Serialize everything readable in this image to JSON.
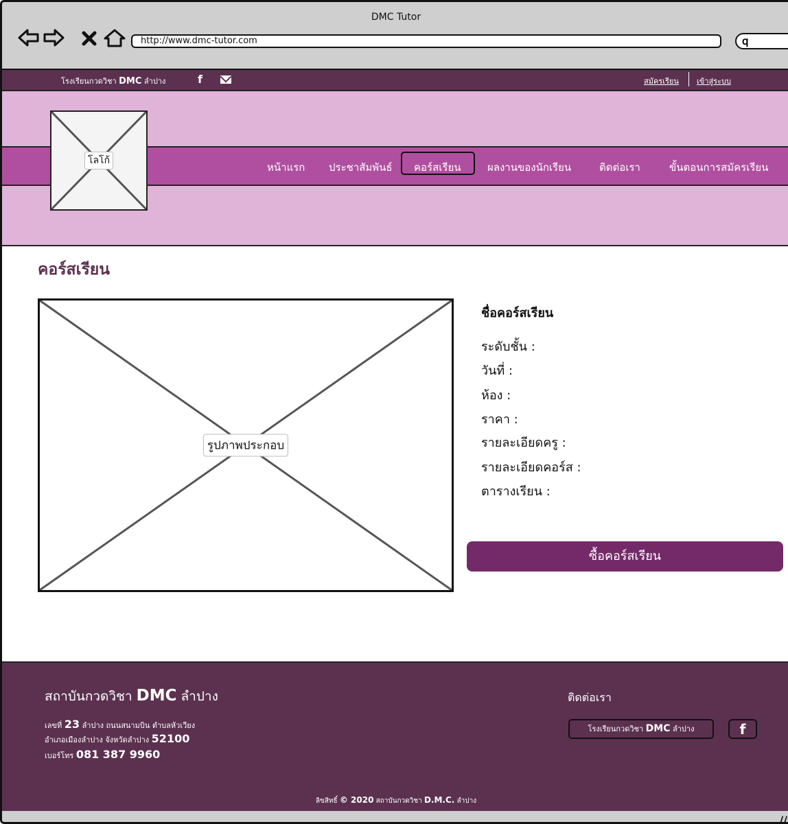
{
  "browser": {
    "title": "DMC Tutor",
    "url": "http://www.dmc-tutor.com",
    "search_icon": "search-icon"
  },
  "topbar": {
    "school_prefix": "โรงเรียนกวดวิชา",
    "school_brand": "DMC",
    "school_suffix": "ลำปาง",
    "facebook_glyph": "f",
    "register_link": "สมัครเรียน",
    "login_link": "เข้าสู่ระบบ"
  },
  "header": {
    "logo_label": "โลโก้",
    "menu": [
      "หน้าแรก",
      "ประชาสัมพันธ์",
      "คอร์สเรียน",
      "ผลงานของนักเรียน",
      "ติดต่อเรา",
      "ขั้นตอนการสมัครเรียน"
    ],
    "active_menu": "คอร์สเรียน"
  },
  "main": {
    "page_title": "คอร์สเรียน",
    "image_label": "รูปภาพประกอบ",
    "course_name": "ชื่อคอร์สเรียน",
    "fields": [
      "ระดับชั้น :",
      "วันที่ :",
      "ห้อง :",
      "ราคา :",
      "รายละเอียดครู :",
      "รายละเอียดคอร์ส :",
      "ตารางเรียน :"
    ],
    "buy_button": "ซื้อคอร์สเรียน"
  },
  "footer": {
    "institute_prefix": "สถาบันกวดวิชา",
    "institute_brand": "DMC",
    "institute_suffix": "ลำปาง",
    "address1_prefix": "เลขที่",
    "address1_num": "23",
    "address1_rest": "ลำปาง ถนนสนามบิน ตำบลหัวเวียง",
    "address2_prefix": "อำเภอเมืองลำปาง จังหวัดลำปาง",
    "address2_zip": "52100",
    "phone_prefix": "เบอร์โทร",
    "phone": "081 387 9960",
    "contact_title": "ติดต่อเรา",
    "contact_btn_prefix": "โรงเรียนกวดวิชา",
    "contact_btn_brand": "DMC",
    "contact_btn_suffix": "ลำปาง",
    "facebook_glyph": "f",
    "copyright_prefix": "ลิขสิทธิ์",
    "copyright_year": "© 2020",
    "copyright_middle": "สถาบันกวดวิชา",
    "copyright_brand": "D.M.C.",
    "copyright_suffix": "ลำปาง"
  },
  "colors": {
    "topbar": "#5c3150",
    "header": "#e0b4d8",
    "navband": "#b04fa0",
    "button": "#742a68",
    "footer": "#5c3150",
    "chrome": "#cfcfcf"
  }
}
